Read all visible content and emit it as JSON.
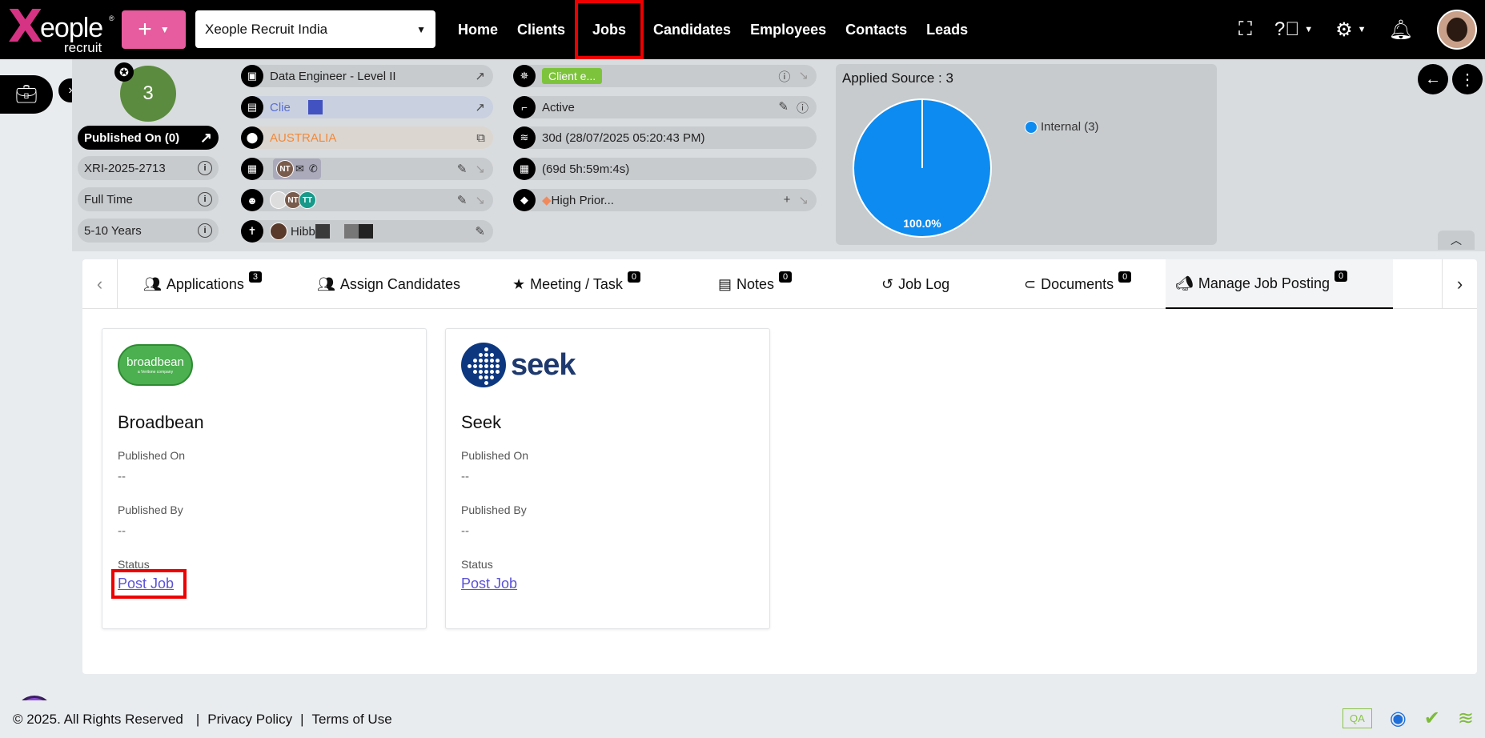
{
  "topbar": {
    "logo_text": "eople",
    "logo_sub": "recruit",
    "logo_x": "X",
    "logo_reg": "®",
    "add_label": "+",
    "company": "Xeople Recruit India",
    "nav": [
      {
        "label": "Home"
      },
      {
        "label": "Clients"
      },
      {
        "label": "Jobs"
      },
      {
        "label": "Candidates"
      },
      {
        "label": "Employees"
      },
      {
        "label": "Contacts"
      },
      {
        "label": "Leads"
      }
    ]
  },
  "summary": {
    "score": "3",
    "published": "Published On (0)",
    "job_code": "XRI-2025-2713",
    "job_type": "Full Time",
    "experience": "5-10 Years",
    "job_title": "Data Engineer - Level II",
    "client": "Clie",
    "location": "AUSTRALIA",
    "contact_initials": "NT",
    "team_initials": [
      "NT",
      "TT"
    ],
    "owner": "Hibb",
    "client_status": "Client e...",
    "status": "Active",
    "age": "30d (28/07/2025 05:20:43 PM)",
    "remaining": "(69d 5h:59m:4s)",
    "priority": "High Prior..."
  },
  "chart_data": {
    "type": "pie",
    "title": "Applied Source : 3",
    "categories": [
      "Internal (3)"
    ],
    "values": [
      100.0
    ],
    "data_labels": [
      "100.0%"
    ],
    "colors": [
      "#0d8bf0"
    ],
    "legend": "right"
  },
  "tabs": [
    {
      "label": "Applications",
      "count": "3",
      "icon": "users-icon"
    },
    {
      "label": "Assign Candidates",
      "count": "",
      "icon": "user-plus-icon"
    },
    {
      "label": "Meeting / Task",
      "count": "0",
      "icon": "star-calendar-icon"
    },
    {
      "label": "Notes",
      "count": "0",
      "icon": "note-icon"
    },
    {
      "label": "Job Log",
      "count": "",
      "icon": "history-icon"
    },
    {
      "label": "Documents",
      "count": "0",
      "icon": "paperclip-icon"
    },
    {
      "label": "Manage Job Posting",
      "count": "0",
      "icon": "megaphone-icon"
    }
  ],
  "postings": [
    {
      "name": "Broadbean",
      "logo_text": "broadbean",
      "logo_sub": "a Veritone company",
      "published_on_label": "Published On",
      "published_on": "--",
      "published_by_label": "Published By",
      "published_by": "--",
      "status_label": "Status",
      "action": "Post Job"
    },
    {
      "name": "Seek",
      "logo_text": "seek",
      "published_on_label": "Published On",
      "published_on": "--",
      "published_by_label": "Published By",
      "published_by": "--",
      "status_label": "Status",
      "action": "Post Job"
    }
  ],
  "footer": {
    "copyright": "© 2025. All Rights Reserved",
    "privacy": "Privacy Policy",
    "terms": "Terms of Use",
    "env": "QA"
  },
  "colors": {
    "accent_pink": "#e75c9e",
    "score_green": "#5b8b3e",
    "link": "#5a52d6",
    "highlight": "#ee0000"
  }
}
